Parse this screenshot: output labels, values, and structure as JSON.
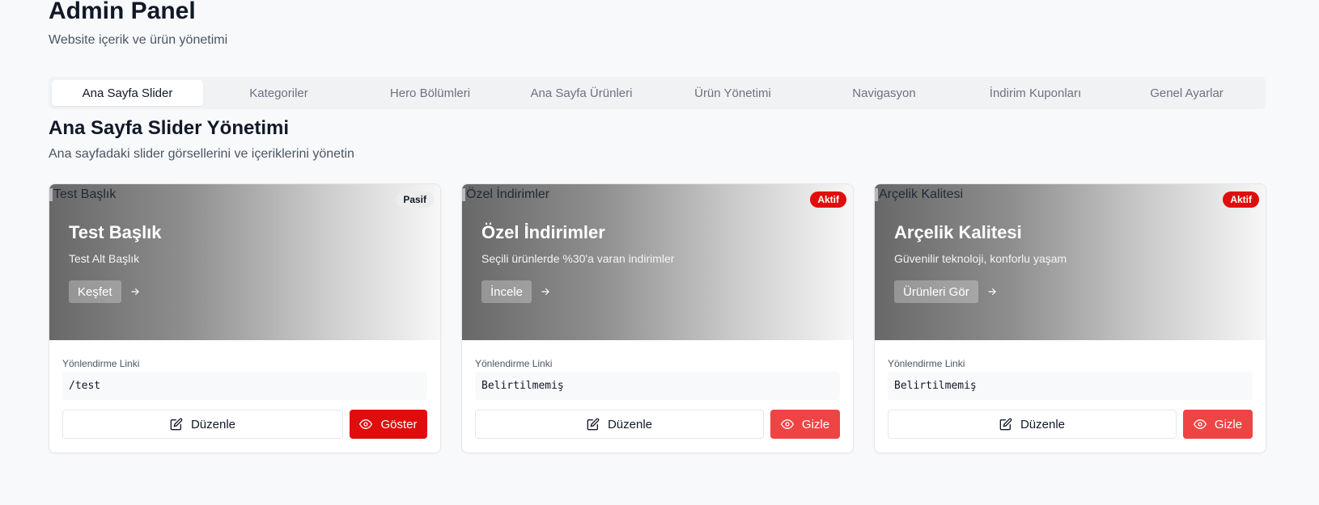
{
  "header": {
    "title": "Admin Panel",
    "subtitle": "Website içerik ve ürün yönetimi"
  },
  "tabs": [
    {
      "label": "Ana Sayfa Slider",
      "active": true
    },
    {
      "label": "Kategoriler"
    },
    {
      "label": "Hero Bölümleri"
    },
    {
      "label": "Ana Sayfa Ürünleri"
    },
    {
      "label": "Ürün Yönetimi"
    },
    {
      "label": "Navigasyon"
    },
    {
      "label": "İndirim Kuponları"
    },
    {
      "label": "Genel Ayarlar"
    }
  ],
  "section": {
    "title": "Ana Sayfa Slider Yönetimi",
    "subtitle": "Ana sayfadaki slider görsellerini ve içeriklerini yönetin"
  },
  "link_label": "Yönlendirme Linki",
  "edit_label": "Düzenle",
  "colors": {
    "active_badge": "#e00d0d",
    "toggle_show": "#e00d0d",
    "toggle_hide": "#ef4444"
  },
  "sliders": [
    {
      "alt": "Test Başlık",
      "status": "Pasif",
      "title": "Test Başlık",
      "subtitle": "Test Alt Başlık",
      "cta": "Keşfet",
      "link": "/test",
      "toggle_label": "Göster",
      "toggle_icon": "eye-icon"
    },
    {
      "alt": "Özel İndirimler",
      "status": "Aktif",
      "title": "Özel İndirimler",
      "subtitle": "Seçili ürünlerde %30'a varan indirimler",
      "cta": "İncele",
      "link": "Belirtilmemiş",
      "toggle_label": "Gizle",
      "toggle_icon": "eye-icon"
    },
    {
      "alt": "Arçelik Kalitesi",
      "status": "Aktif",
      "title": "Arçelik Kalitesi",
      "subtitle": "Güvenilir teknoloji, konforlu yaşam",
      "cta": "Ürünleri Gör",
      "link": "Belirtilmemiş",
      "toggle_label": "Gizle",
      "toggle_icon": "eye-icon"
    }
  ]
}
